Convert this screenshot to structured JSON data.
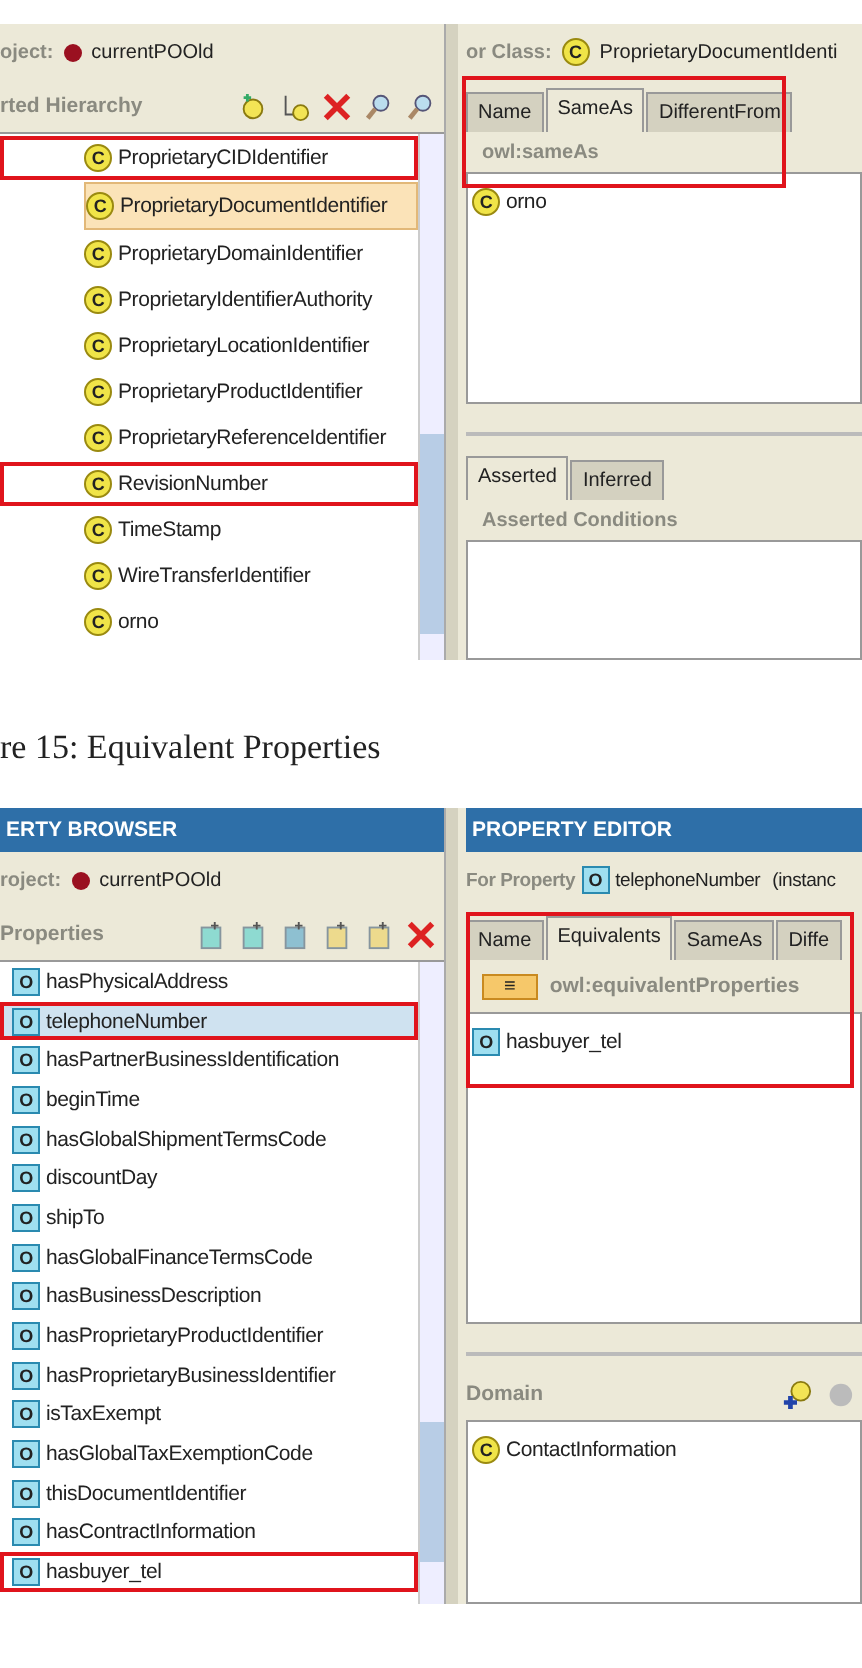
{
  "top_screen": {
    "browser": {
      "project_label": "oject:",
      "project": "currentPOOld",
      "section_title": "rted Hierarchy",
      "items": [
        {
          "badge": "C",
          "kind": "class",
          "label": "ProprietaryCIDIdentifier",
          "selected": false,
          "marked": true
        },
        {
          "badge": "C",
          "kind": "class",
          "label": "ProprietaryDocumentIdentifier",
          "selected": true,
          "marked": false
        },
        {
          "badge": "C",
          "kind": "class",
          "label": "ProprietaryDomainIdentifier",
          "selected": false,
          "marked": false
        },
        {
          "badge": "C",
          "kind": "class",
          "label": "ProprietaryIdentifierAuthority",
          "selected": false,
          "marked": false
        },
        {
          "badge": "C",
          "kind": "class",
          "label": "ProprietaryLocationIdentifier",
          "selected": false,
          "marked": false
        },
        {
          "badge": "C",
          "kind": "class",
          "label": "ProprietaryProductIdentifier",
          "selected": false,
          "marked": false
        },
        {
          "badge": "C",
          "kind": "class",
          "label": "ProprietaryReferenceIdentifier",
          "selected": false,
          "marked": false
        },
        {
          "badge": "C",
          "kind": "class",
          "label": "RevisionNumber",
          "selected": false,
          "marked": true
        },
        {
          "badge": "C",
          "kind": "class",
          "label": "TimeStamp",
          "selected": false,
          "marked": false
        },
        {
          "badge": "C",
          "kind": "class",
          "label": "WireTransferIdentifier",
          "selected": false,
          "marked": false
        },
        {
          "badge": "C",
          "kind": "class",
          "label": "orno",
          "selected": false,
          "marked": false
        }
      ]
    },
    "editor": {
      "for_label": "or Class:",
      "for_badge": {
        "badge": "C",
        "kind": "class"
      },
      "for_value": "ProprietaryDocumentIdenti",
      "tabs_marked": true,
      "tabs": [
        {
          "label": "Name",
          "selected": false
        },
        {
          "label": "SameAs",
          "selected": true
        },
        {
          "label": "DifferentFrom",
          "selected": false
        }
      ],
      "list_title": "owl:sameAs",
      "list_items": [
        {
          "badge": "C",
          "kind": "class",
          "label": "orno"
        }
      ],
      "lower_tabs": [
        {
          "label": "Asserted",
          "selected": true
        },
        {
          "label": "Inferred",
          "selected": false
        }
      ],
      "lower_title": "Asserted Conditions"
    }
  },
  "caption": "re 15: Equivalent Properties",
  "bottom_screen": {
    "browser": {
      "title": "ERTY BROWSER",
      "project_label": "roject:",
      "project": "currentPOOld",
      "section_title": "Properties",
      "items": [
        {
          "badge": "O",
          "kind": "property",
          "label": "hasPhysicalAddress",
          "selected": false,
          "marked": false
        },
        {
          "badge": "O",
          "kind": "property",
          "label": "telephoneNumber",
          "selected": true,
          "marked": true
        },
        {
          "badge": "O",
          "kind": "property",
          "label": "hasPartnerBusinessIdentification",
          "selected": false,
          "marked": false
        },
        {
          "badge": "O",
          "kind": "property",
          "label": "beginTime",
          "selected": false,
          "marked": false
        },
        {
          "badge": "O",
          "kind": "property",
          "label": "hasGlobalShipmentTermsCode",
          "selected": false,
          "marked": false
        },
        {
          "badge": "O",
          "kind": "property",
          "label": "discountDay",
          "selected": false,
          "marked": false
        },
        {
          "badge": "O",
          "kind": "property",
          "label": "shipTo",
          "selected": false,
          "marked": false
        },
        {
          "badge": "O",
          "kind": "property",
          "label": "hasGlobalFinanceTermsCode",
          "selected": false,
          "marked": false
        },
        {
          "badge": "O",
          "kind": "property",
          "label": "hasBusinessDescription",
          "selected": false,
          "marked": false
        },
        {
          "badge": "O",
          "kind": "property",
          "label": "hasProprietaryProductIdentifier",
          "selected": false,
          "marked": false
        },
        {
          "badge": "O",
          "kind": "property",
          "label": "hasProprietaryBusinessIdentifier",
          "selected": false,
          "marked": false
        },
        {
          "badge": "O",
          "kind": "property",
          "label": "isTaxExempt",
          "selected": false,
          "marked": false
        },
        {
          "badge": "O",
          "kind": "property",
          "label": "hasGlobalTaxExemptionCode",
          "selected": false,
          "marked": false
        },
        {
          "badge": "O",
          "kind": "property",
          "label": "thisDocumentIdentifier",
          "selected": false,
          "marked": false
        },
        {
          "badge": "O",
          "kind": "property",
          "label": "hasContractInformation",
          "selected": false,
          "marked": false
        },
        {
          "badge": "O",
          "kind": "property",
          "label": "hasbuyer_tel",
          "selected": false,
          "marked": true
        }
      ]
    },
    "editor": {
      "title": "PROPERTY EDITOR",
      "for_label": "For Property",
      "for_badge": {
        "badge": "O",
        "kind": "property"
      },
      "for_value": "telephoneNumber",
      "for_extra": "(instanc",
      "tabs_marked": true,
      "tabs": [
        {
          "label": "Name",
          "selected": false
        },
        {
          "label": "Equivalents",
          "selected": true
        },
        {
          "label": "SameAs",
          "selected": false
        },
        {
          "label": "Diffe",
          "selected": false
        }
      ],
      "list_badge": "≡",
      "list_title": "owl:equivalentProperties",
      "list_items": [
        {
          "badge": "O",
          "kind": "property",
          "label": "hasbuyer_tel"
        }
      ],
      "domain_title": "Domain",
      "domain_items": [
        {
          "badge": "C",
          "kind": "class",
          "label": "ContactInformation"
        }
      ]
    }
  }
}
